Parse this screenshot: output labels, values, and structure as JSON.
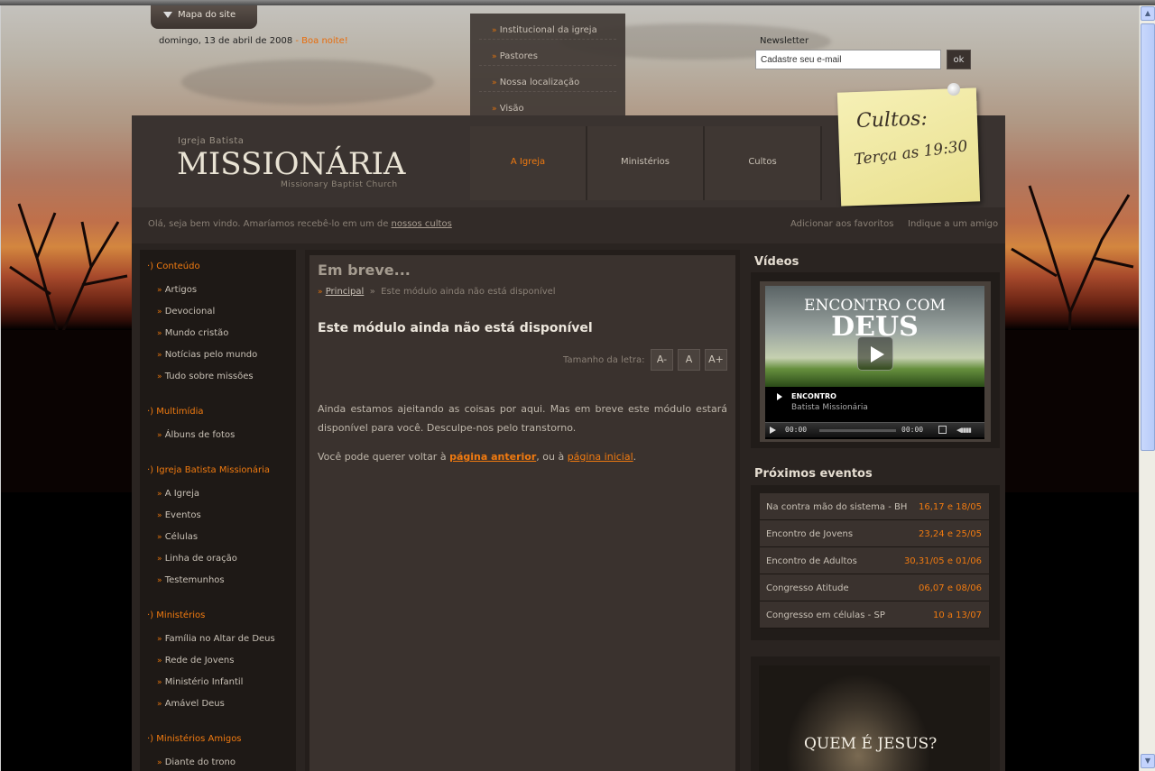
{
  "top": {
    "sitemap_label": "Mapa do site",
    "date": "domingo, 13 de abril de 2008",
    "greeting": "- Boa noite!",
    "submenu": [
      "Institucional da igreja",
      "Pastores",
      "Nossa localização",
      "Visão"
    ],
    "newsletter_label": "Newsletter",
    "newsletter_value": "Cadastre seu e-mail",
    "newsletter_button": "ok"
  },
  "logo": {
    "small": "Igreja Batista",
    "main": "MISSIONÁRIA",
    "sub": "Missionary Baptist Church"
  },
  "nav": {
    "tabs": [
      {
        "label": "A Igreja",
        "active": true
      },
      {
        "label": "Ministérios",
        "active": false
      },
      {
        "label": "Cultos",
        "active": false
      }
    ]
  },
  "postit": {
    "title": "Cultos:",
    "time": "Terça as 19:30"
  },
  "welcome": {
    "text": "Olá, seja bem vindo. Amaríamos recebê-lo em um de ",
    "link": "nossos cultos",
    "favorites": "Adicionar aos favoritos",
    "indicate": "Indique a um amigo"
  },
  "sidebar": {
    "sections": [
      {
        "title": "Conteúdo",
        "items": [
          "Artigos",
          "Devocional",
          "Mundo cristão",
          "Notícias pelo mundo",
          "Tudo sobre missões"
        ]
      },
      {
        "title": "Multimídia",
        "items": [
          "Álbuns de fotos"
        ]
      },
      {
        "title": "Igreja Batista Missionária",
        "items": [
          "A Igreja",
          "Eventos",
          "Células",
          "Linha de oração",
          "Testemunhos"
        ]
      },
      {
        "title": "Ministérios",
        "items": [
          "Família no Altar de Deus",
          "Rede de Jovens",
          "Ministério Infantil",
          "Amável Deus"
        ]
      },
      {
        "title": "Ministérios Amigos",
        "items": [
          "Diante do trono"
        ]
      }
    ]
  },
  "main": {
    "heading": "Em breve...",
    "breadcrumb_home": "Principal",
    "breadcrumb_sep": "»",
    "breadcrumb_current": "Este módulo ainda não está disponível",
    "title": "Este módulo ainda não está disponível",
    "font_size_label": "Tamanho da letra:",
    "font_buttons": [
      "A-",
      "A",
      "A+"
    ],
    "para1": "Ainda estamos ajeitando as coisas por aqui. Mas em breve este módulo estará disponível para você. Desculpe-nos pelo transtorno.",
    "para2_prefix": "Você pode querer voltar à ",
    "para2_link1": "página anterior",
    "para2_mid": ", ou à ",
    "para2_link2": "página inicial",
    "para2_suffix": "."
  },
  "videos": {
    "title": "Vídeos",
    "video_title_line1": "ENCONTRO COM",
    "video_title_line2": "DEUS",
    "caption_title": "ENCONTRO",
    "caption_sub": "Batista Missionária",
    "time_current": "00:00",
    "time_total": "00:00"
  },
  "events": {
    "title": "Próximos eventos",
    "rows": [
      {
        "name": "Na contra mão do sistema - BH",
        "date": "16,17 e 18/05"
      },
      {
        "name": "Encontro de Jovens",
        "date": "23,24 e 25/05"
      },
      {
        "name": "Encontro de Adultos",
        "date": "30,31/05 e 01/06"
      },
      {
        "name": "Congresso Atitude",
        "date": "06,07 e 08/06"
      },
      {
        "name": "Congresso em células - SP",
        "date": "10 a 13/07"
      }
    ]
  },
  "promo": {
    "text": "QUEM É JESUS?"
  },
  "colors": {
    "accent": "#f07a10",
    "panel": "#3a322e",
    "dark": "#1e1916"
  }
}
